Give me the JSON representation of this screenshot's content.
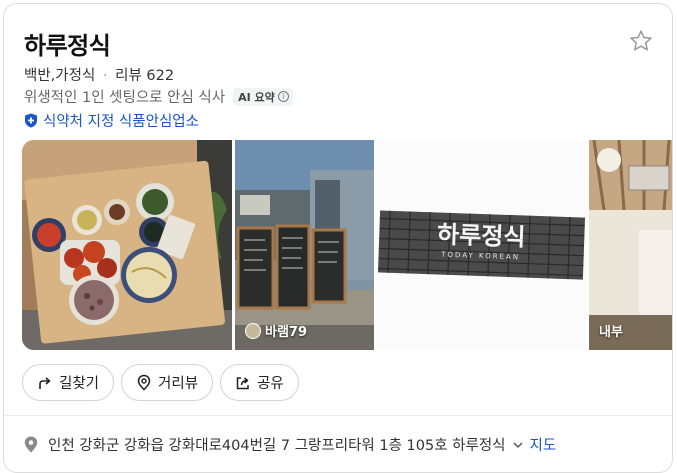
{
  "place": {
    "name": "하루정식",
    "category": "백반,가정식",
    "separator": "·",
    "reviews": "리뷰 622",
    "summary": "위생적인 1인 셋팅으로 안심 식사",
    "ai_badge": "AI 요약",
    "info_glyph": "i",
    "certification": "식약처 지정 식품안심업소"
  },
  "photos": {
    "sign_text": "하루정식",
    "sign_subtext": "TODAY KOREAN",
    "captions": [
      "바램79",
      "내부"
    ]
  },
  "actions": {
    "directions": "길찾기",
    "street_view": "거리뷰",
    "share": "공유"
  },
  "address": {
    "text": "인천 강화군 강화읍 강화대로404번길 7 그랑프리타워 1층 105호 하루정식",
    "map_link": "지도"
  },
  "colors": {
    "link_blue": "#1a55c9",
    "border": "#dcdcdc"
  }
}
